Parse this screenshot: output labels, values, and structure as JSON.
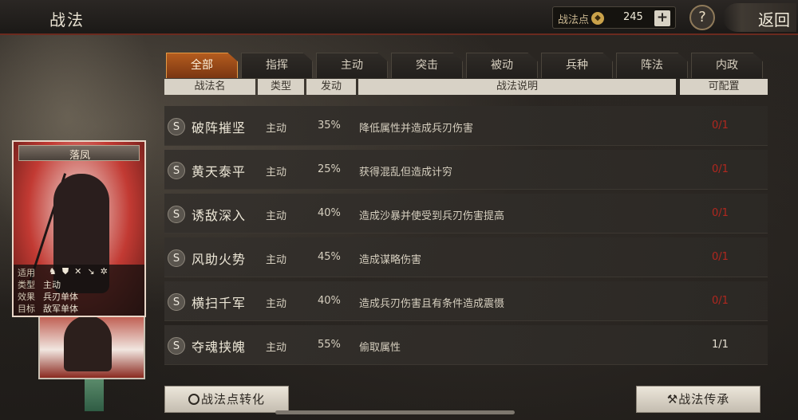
{
  "header": {
    "title": "战法",
    "points_label": "战法点",
    "points_value": "245",
    "plus": "+",
    "help": "?",
    "back": "返回"
  },
  "tabs": [
    {
      "label": "全部",
      "active": true
    },
    {
      "label": "指挥",
      "active": false
    },
    {
      "label": "主动",
      "active": false
    },
    {
      "label": "突击",
      "active": false
    },
    {
      "label": "被动",
      "active": false
    },
    {
      "label": "兵种",
      "active": false
    },
    {
      "label": "阵法",
      "active": false
    },
    {
      "label": "内政",
      "active": false
    }
  ],
  "columns": {
    "name": "战法名",
    "type": "类型",
    "trigger": "发动",
    "desc": "战法说明",
    "config": "可配置"
  },
  "rows": [
    {
      "grade": "S",
      "name": "破阵摧坚",
      "type": "主动",
      "rate": "35%",
      "desc": "降低属性并造成兵刃伤害",
      "config": "0/1",
      "available": false
    },
    {
      "grade": "S",
      "name": "黄天泰平",
      "type": "主动",
      "rate": "25%",
      "desc": "获得混乱但造成计穷",
      "config": "0/1",
      "available": false
    },
    {
      "grade": "S",
      "name": "诱敌深入",
      "type": "主动",
      "rate": "40%",
      "desc": "造成沙暴并使受到兵刃伤害提高",
      "config": "0/1",
      "available": false
    },
    {
      "grade": "S",
      "name": "风助火势",
      "type": "主动",
      "rate": "45%",
      "desc": "造成谋略伤害",
      "config": "0/1",
      "available": false
    },
    {
      "grade": "S",
      "name": "横扫千军",
      "type": "主动",
      "rate": "40%",
      "desc": "造成兵刃伤害且有条件造成震慑",
      "config": "0/1",
      "available": false
    },
    {
      "grade": "S",
      "name": "夺魂挟魄",
      "type": "主动",
      "rate": "55%",
      "desc": "偷取属性",
      "config": "1/1",
      "available": true
    }
  ],
  "card": {
    "title": "落凤",
    "fit_label": "适用",
    "type_label": "类型",
    "type_value": "主动",
    "effect_label": "效果",
    "effect_value": "兵刃单体",
    "target_label": "目标",
    "target_value": "敌军单体"
  },
  "buttons": {
    "convert": "战法点转化",
    "inherit": "战法传承"
  },
  "colors": {
    "accent": "#b45c1e",
    "unavailable": "#b1271f"
  }
}
